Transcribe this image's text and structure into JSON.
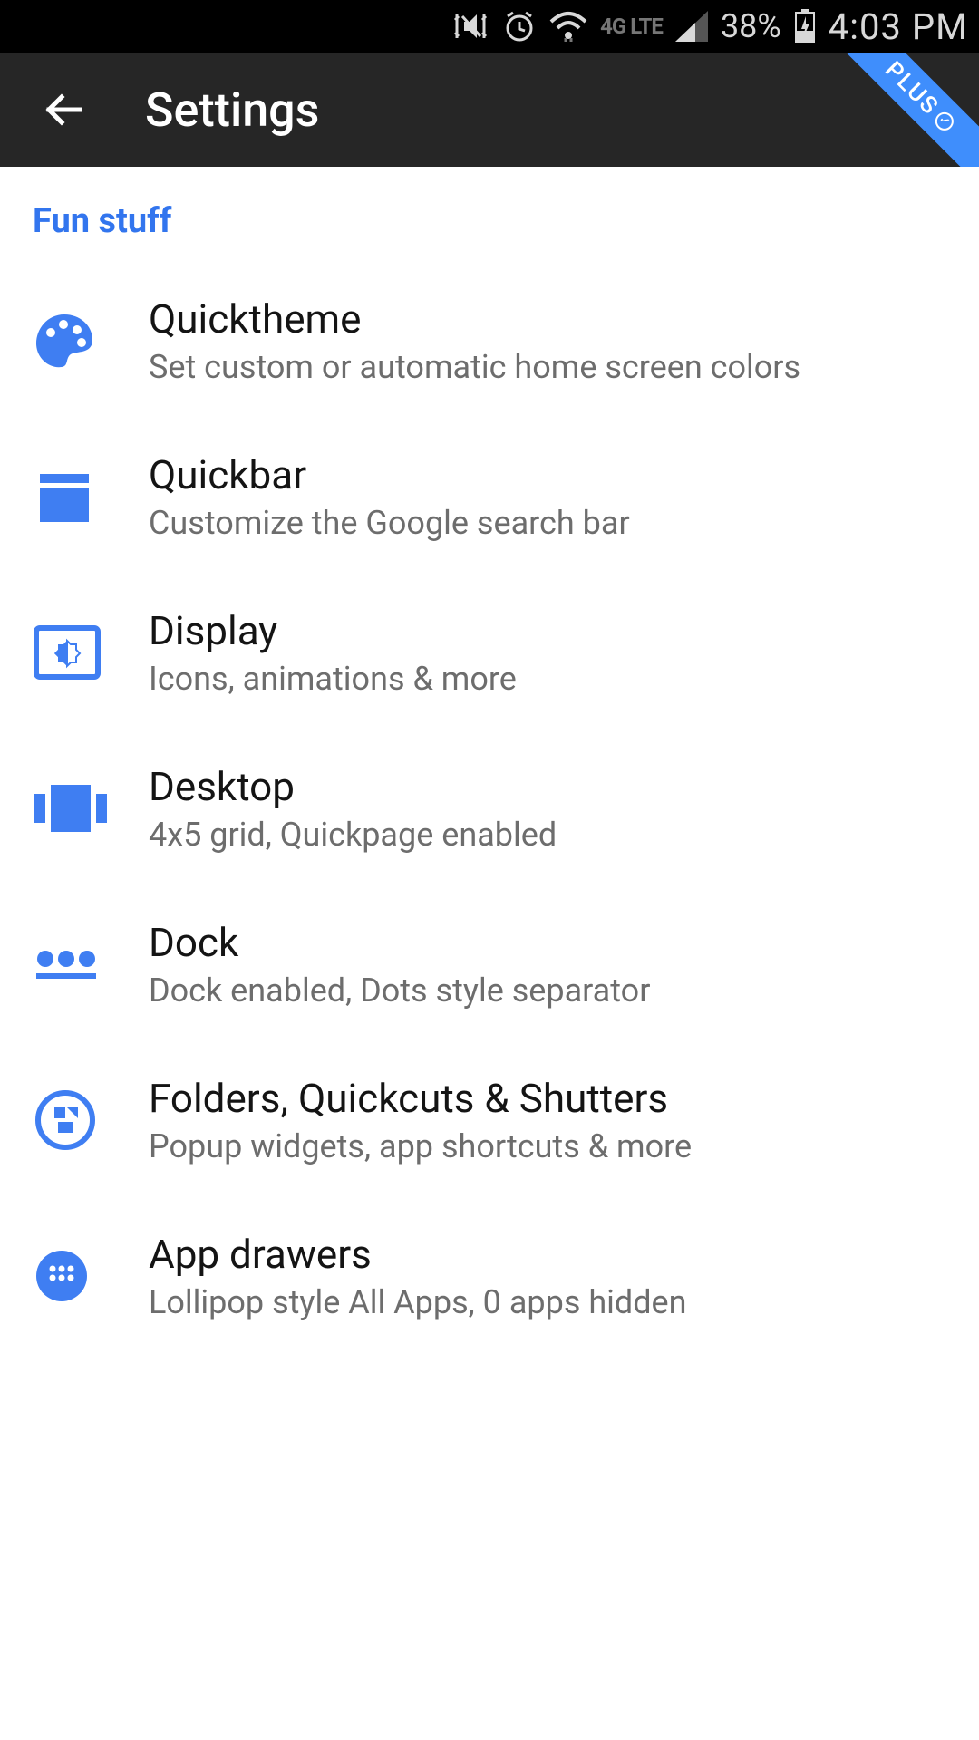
{
  "status": {
    "network_label": "4G LTE",
    "battery": "38%",
    "time": "4:03 PM"
  },
  "appbar": {
    "title": "Settings",
    "plus_label": "PLUS"
  },
  "section": {
    "header": "Fun stuff"
  },
  "items": [
    {
      "title": "Quicktheme",
      "subtitle": "Set custom or automatic home screen colors",
      "icon": "palette"
    },
    {
      "title": "Quickbar",
      "subtitle": "Customize the Google search bar",
      "icon": "quickbar"
    },
    {
      "title": "Display",
      "subtitle": "Icons, animations & more",
      "icon": "display"
    },
    {
      "title": "Desktop",
      "subtitle": "4x5 grid, Quickpage enabled",
      "icon": "desktop"
    },
    {
      "title": "Dock",
      "subtitle": "Dock enabled, Dots style separator",
      "icon": "dock"
    },
    {
      "title": "Folders, Quickcuts & Shutters",
      "subtitle": "Popup widgets, app shortcuts & more",
      "icon": "folders"
    },
    {
      "title": "App drawers",
      "subtitle": "Lollipop style All Apps, 0 apps hidden",
      "icon": "drawer"
    }
  ],
  "colors": {
    "accent": "#3f7ef2",
    "header_accent": "#3275ee"
  }
}
